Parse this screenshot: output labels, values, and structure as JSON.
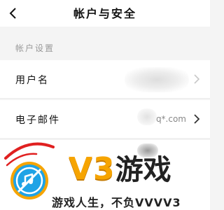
{
  "header": {
    "title": "帐户与安全"
  },
  "section": {
    "label": "帐户设置"
  },
  "rows": [
    {
      "label": "用户名"
    },
    {
      "label": "电子邮件",
      "value": "@q*.com"
    }
  ],
  "watermark": {
    "brand": "V3",
    "brand_cn": "游戏",
    "slogan": "游戏人生，不负VVVV3",
    "colors": {
      "gold": "#f6a400",
      "blue": "#1fa3e6",
      "red": "#e02020"
    }
  }
}
